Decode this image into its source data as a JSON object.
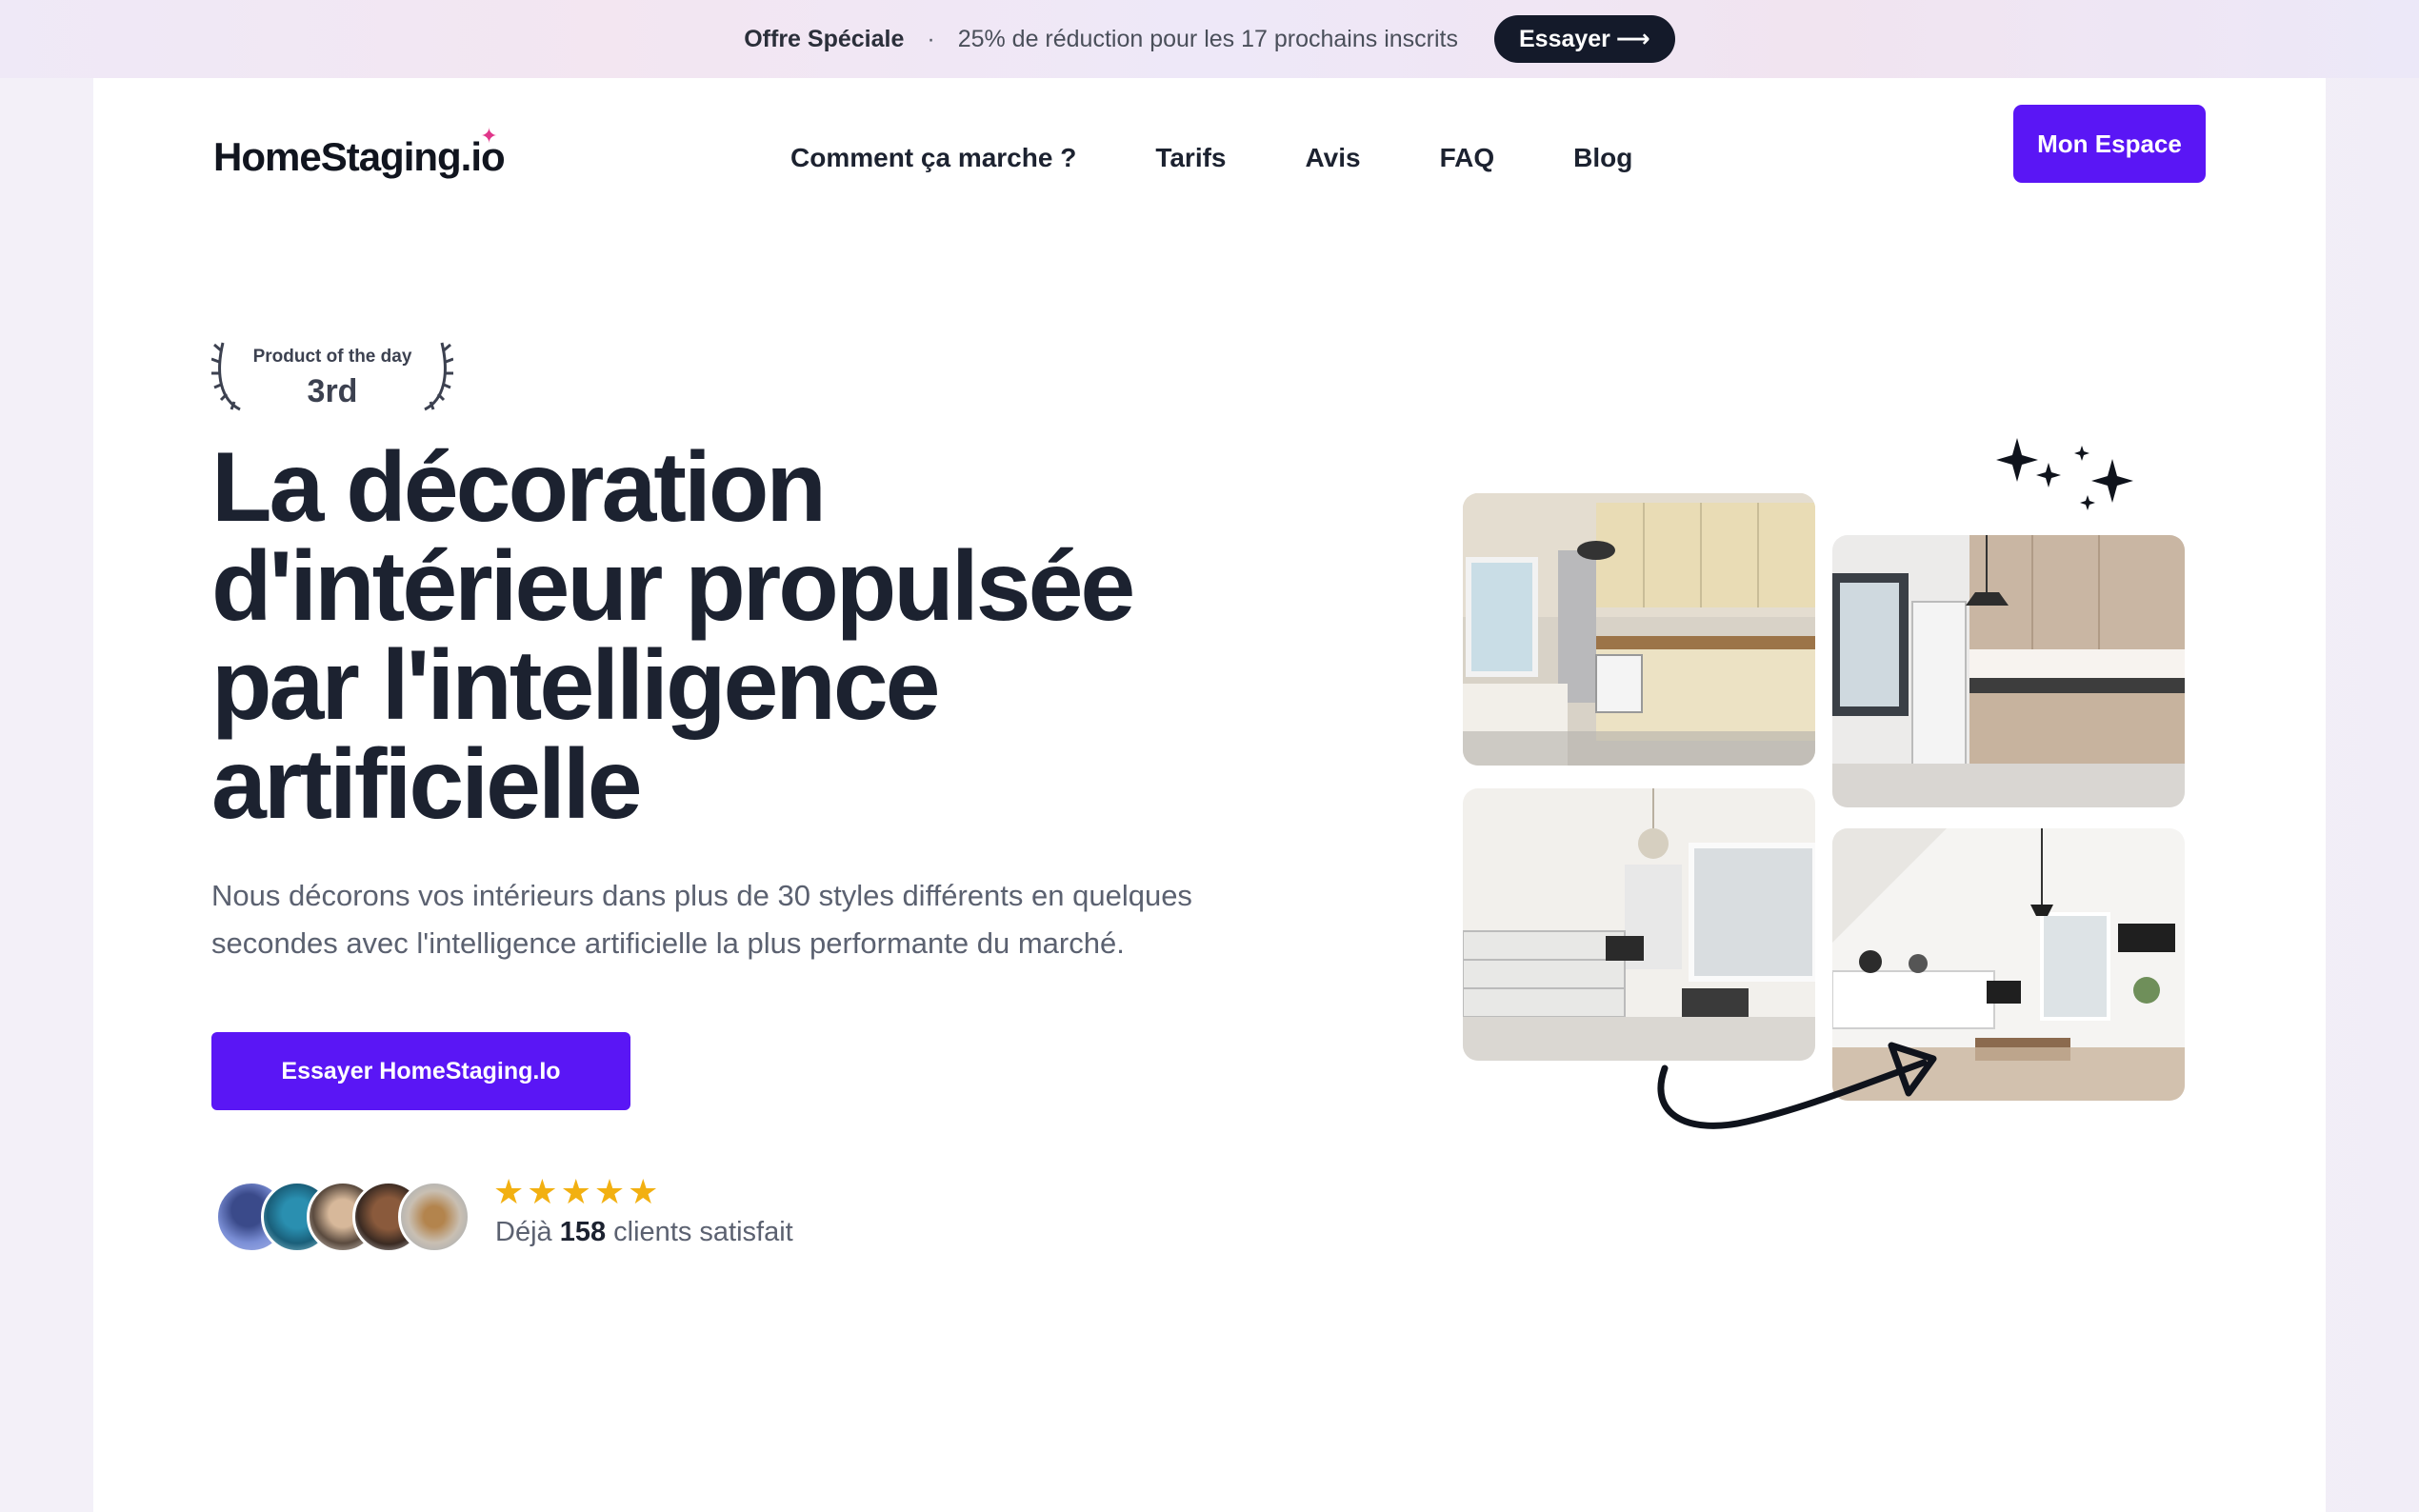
{
  "promo": {
    "title": "Offre Spéciale",
    "separator": "·",
    "text": "25% de réduction pour les 17 prochains inscrits",
    "button_label": "Essayer",
    "button_arrow": "⟶"
  },
  "header": {
    "logo_text": "HomeStaging.io",
    "nav": [
      {
        "label": "Comment ça marche ?"
      },
      {
        "label": "Tarifs"
      },
      {
        "label": "Avis"
      },
      {
        "label": "FAQ"
      },
      {
        "label": "Blog"
      }
    ],
    "account_button": "Mon Espace"
  },
  "badge": {
    "label": "Product of the day",
    "rank": "3rd"
  },
  "hero": {
    "title_lines": [
      "La décoration",
      "d'intérieur propulsée",
      "par l'intelligence",
      "artificielle"
    ],
    "subtitle_lines": [
      "Nous décorons vos intérieurs dans plus de 30 styles différents en quelques",
      "secondes avec l'intelligence artificielle la plus performante du marché."
    ],
    "cta_label": "Essayer HomeStaging.Io"
  },
  "social_proof": {
    "rating_stars": 5,
    "prefix": "Déjà",
    "count": "158",
    "suffix": "clients satisfait"
  },
  "gallery": {
    "images": [
      {
        "name": "kitchen-before"
      },
      {
        "name": "kitchen-after"
      },
      {
        "name": "living-room-before"
      },
      {
        "name": "living-room-after"
      }
    ]
  },
  "colors": {
    "brand": "#5a16f5",
    "dark": "#1c2230",
    "star": "#f2b011",
    "logo_spark": "#e0368a"
  }
}
